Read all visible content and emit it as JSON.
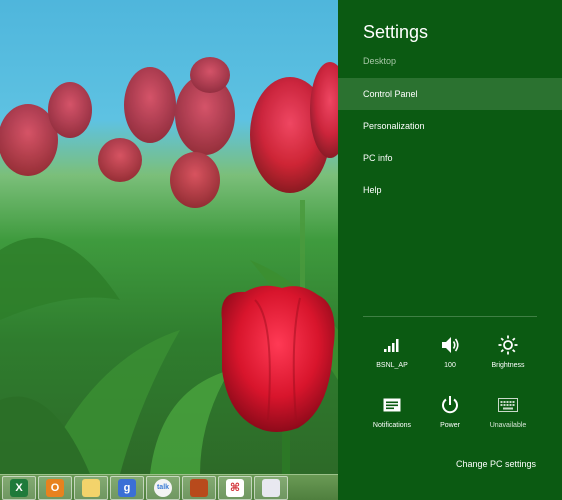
{
  "settings": {
    "title": "Settings",
    "context": "Desktop",
    "items": [
      {
        "label": "Control Panel",
        "selected": true
      },
      {
        "label": "Personalization",
        "selected": false
      },
      {
        "label": "PC info",
        "selected": false
      },
      {
        "label": "Help",
        "selected": false
      }
    ],
    "quick": [
      {
        "icon": "wifi-signal-icon",
        "label": "BSNL_AP"
      },
      {
        "icon": "speaker-volume-icon",
        "label": "100"
      },
      {
        "icon": "brightness-sun-icon",
        "label": "Brightness"
      },
      {
        "icon": "notifications-icon",
        "label": "Notifications"
      },
      {
        "icon": "power-icon",
        "label": "Power"
      },
      {
        "icon": "keyboard-icon",
        "label": "Unavailable"
      }
    ],
    "change_pc_settings": "Change PC settings"
  },
  "taskbar": {
    "apps": [
      {
        "icon": "excel-icon",
        "name": "Excel",
        "glyph": "X",
        "color": "#1f7a3a"
      },
      {
        "icon": "outlook-icon",
        "name": "Outlook",
        "glyph": "O",
        "color": "#e8821e"
      },
      {
        "icon": "file-explorer-icon",
        "name": "File Explorer",
        "glyph": "",
        "color": "#f3d36b"
      },
      {
        "icon": "google-icon",
        "name": "Google",
        "glyph": "g",
        "color": "#3b6fd6"
      },
      {
        "icon": "google-talk-icon",
        "name": "Google Talk",
        "glyph": "talk",
        "color": "#f4f4f4"
      },
      {
        "icon": "media-app-icon",
        "name": "Media app",
        "glyph": "",
        "color": "#b84a1c"
      },
      {
        "icon": "adobe-reader-icon",
        "name": "Adobe Reader",
        "glyph": "",
        "color": "#ffffff"
      },
      {
        "icon": "paint-icon",
        "name": "Paint",
        "glyph": "",
        "color": "#e8e8f0"
      }
    ]
  }
}
